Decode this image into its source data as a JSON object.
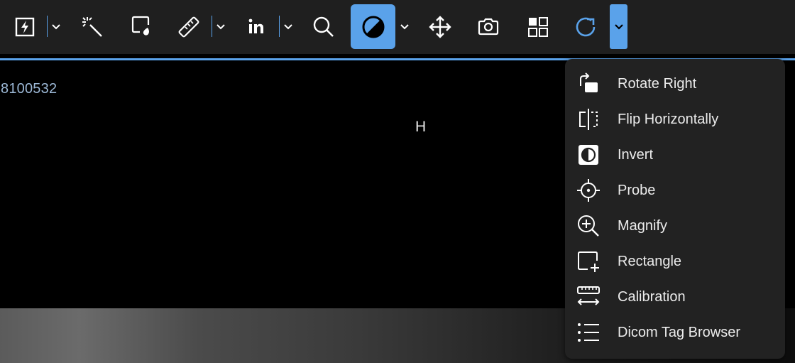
{
  "overlay": {
    "patient_id": "8100532",
    "orientation_marker": "H"
  },
  "toolbar": {
    "tools": [
      "lightning-icon",
      "magic-wand-icon",
      "annotation-icon",
      "ruler-icon",
      "linkedin-icon",
      "search-icon",
      "contrast-icon",
      "move-icon",
      "camera-icon",
      "layout-icon",
      "reset-icon"
    ],
    "active_tool": "contrast-icon",
    "accent_color": "#5aa2ea"
  },
  "more_menu": {
    "items": [
      {
        "icon": "rotate-right-icon",
        "label": "Rotate Right"
      },
      {
        "icon": "flip-horizontal-icon",
        "label": "Flip Horizontally"
      },
      {
        "icon": "invert-icon",
        "label": "Invert"
      },
      {
        "icon": "probe-icon",
        "label": "Probe"
      },
      {
        "icon": "magnify-icon",
        "label": "Magnify"
      },
      {
        "icon": "rectangle-icon",
        "label": "Rectangle"
      },
      {
        "icon": "calibration-icon",
        "label": "Calibration"
      },
      {
        "icon": "list-icon",
        "label": "Dicom Tag Browser"
      }
    ]
  }
}
